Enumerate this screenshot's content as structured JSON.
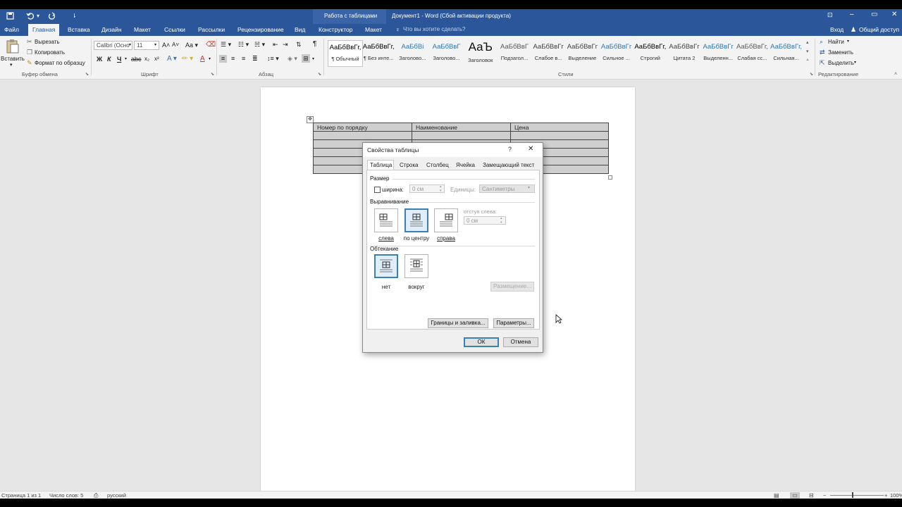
{
  "titlebar": {
    "context_label": "Работа с таблицами",
    "title": "Документ1 - Word (Сбой активации продукта)"
  },
  "menu": {
    "items": [
      "Файл",
      "Главная",
      "Вставка",
      "Дизайн",
      "Макет",
      "Ссылки",
      "Рассылки",
      "Рецензирование",
      "Вид",
      "Конструктор",
      "Макет"
    ],
    "search_placeholder": "Что вы хотите сделать?",
    "login": "Вход",
    "share": "Общий доступ"
  },
  "ribbon": {
    "clipboard": {
      "paste": "Вставить",
      "cut": "Вырезать",
      "copy": "Копировать",
      "format_painter": "Формат по образцу",
      "group": "Буфер обмена"
    },
    "font": {
      "name": "Calibri (Осно",
      "size": "11",
      "group": "Шрифт",
      "bold": "Ж",
      "italic": "К",
      "underline": "Ч"
    },
    "paragraph": {
      "group": "Абзац"
    },
    "styles": {
      "group": "Стили",
      "items": [
        {
          "preview": "АаБбВвГг,",
          "name": "¶ Обычный",
          "color": "#000000"
        },
        {
          "preview": "АаБбВвГг,",
          "name": "¶ Без инте...",
          "color": "#000000"
        },
        {
          "preview": "АаБбВі",
          "name": "Заголово...",
          "color": "#2e74b5"
        },
        {
          "preview": "АаБбВвГ",
          "name": "Заголово...",
          "color": "#2e74b5"
        },
        {
          "preview": "АаЪ",
          "name": "Заголовок",
          "color": "#111111"
        },
        {
          "preview": "АаБбВвГ",
          "name": "Подзагол...",
          "color": "#595959"
        },
        {
          "preview": "АаБбВвГг",
          "name": "Слабое в...",
          "color": "#404040"
        },
        {
          "preview": "АаБбВвГг",
          "name": "Выделение",
          "color": "#404040"
        },
        {
          "preview": "АаБбВвГг",
          "name": "Сильное ...",
          "color": "#2e74b5"
        },
        {
          "preview": "АаБбВвГг,",
          "name": "Строгий",
          "color": "#000000"
        },
        {
          "preview": "АаБбВвГг",
          "name": "Цитата 2",
          "color": "#404040"
        },
        {
          "preview": "АаБбВвГг",
          "name": "Выделенн...",
          "color": "#2e74b5"
        },
        {
          "preview": "АаБбВвГг,",
          "name": "Слабая сс...",
          "color": "#595959"
        },
        {
          "preview": "АаБбВвГг,",
          "name": "Сильная...",
          "color": "#2e74b5"
        }
      ]
    },
    "editing": {
      "find": "Найти",
      "replace": "Заменить",
      "select": "Выделить",
      "group": "Редактирование"
    }
  },
  "document": {
    "table_headers": [
      "Номер по порядку",
      "Наименование",
      "Цена"
    ],
    "empty_rows": 5
  },
  "dialog": {
    "title": "Свойства таблицы",
    "help": "?",
    "close": "✕",
    "tabs": [
      "Таблица",
      "Строка",
      "Столбец",
      "Ячейка",
      "Замещающий текст"
    ],
    "size": {
      "section": "Размер",
      "width_label": "ширина:",
      "width_value": "0 см",
      "units_label": "Единицы:",
      "units_value": "Сантиметры"
    },
    "alignment": {
      "section": "Выравнивание",
      "options": [
        "слева",
        "по центру",
        "справа"
      ],
      "indent_label": "отступ слева:",
      "indent_value": "0 см"
    },
    "wrapping": {
      "section": "Обтекание",
      "options": [
        "нет",
        "вокруг"
      ],
      "placement_button": "Размещение..."
    },
    "borders_button": "Границы и заливка...",
    "params_button": "Параметры...",
    "ok": "ОК",
    "cancel": "Отмена"
  },
  "status": {
    "page": "Страница 1 из 1",
    "words": "Число слов: 5",
    "language": "русский",
    "zoom": "100%"
  }
}
